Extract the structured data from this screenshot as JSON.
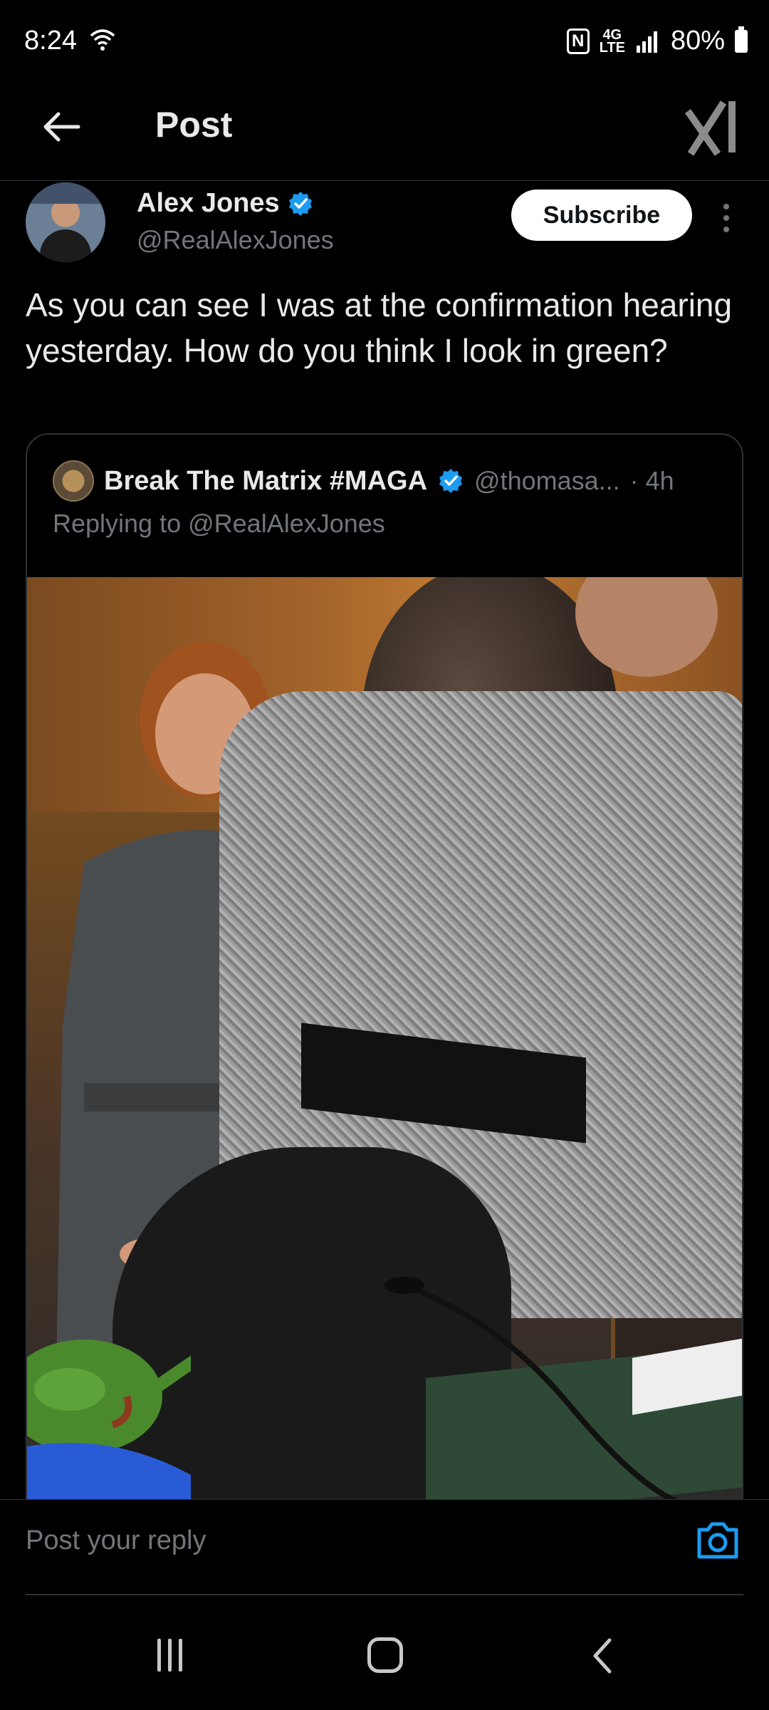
{
  "status_bar": {
    "time": "8:24",
    "network": "4G LTE",
    "battery": "80%"
  },
  "header": {
    "title": "Post"
  },
  "post": {
    "author_name": "Alex Jones",
    "author_handle": "@RealAlexJones",
    "subscribe_label": "Subscribe",
    "text": "As you can see I was at the confirmation hearing yesterday. How do you think I look in green?",
    "quote": {
      "author_name": "Break The Matrix #MAGA",
      "author_handle": "@thomasa...",
      "time": "· 4h",
      "replying_prefix": "Replying to ",
      "replying_to": "@RealAlexJones"
    }
  },
  "reply": {
    "placeholder": "Post your reply"
  },
  "colors": {
    "background": "#000000",
    "text_primary": "#e7e9ea",
    "text_secondary": "#71767b",
    "accent": "#1d9bf0",
    "divider": "#2f3336"
  },
  "icons": {
    "back": "arrow-left-icon",
    "logo": "x-logo-icon",
    "verified": "verified-badge-icon",
    "more": "more-vertical-icon",
    "camera": "camera-icon"
  }
}
